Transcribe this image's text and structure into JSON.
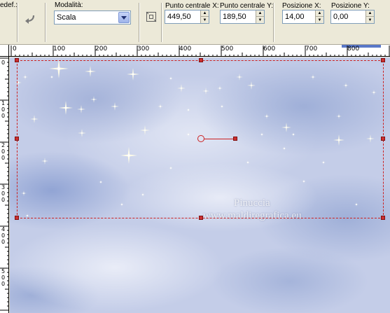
{
  "toolbar": {
    "preset_label": "edef.:",
    "mode": {
      "label": "Modalità:",
      "value": "Scala"
    },
    "center_x": {
      "label": "Punto centrale X:",
      "value": "449,50"
    },
    "center_y": {
      "label": "Punto centrale Y:",
      "value": "189,50"
    },
    "pos_x": {
      "label": "Posizione X:",
      "value": "14,00"
    },
    "pos_y": {
      "label": "Posizione Y:",
      "value": "0,00"
    }
  },
  "ruler_top": [
    "0",
    "100",
    "200",
    "300",
    "400",
    "500",
    "600",
    "700",
    "800"
  ],
  "ruler_left": [
    "0",
    "1\n0\n0",
    "2\n0\n0",
    "3\n0\n0",
    "4\n0\n0",
    "5\n0\n0"
  ],
  "canvas": {
    "watermark_line1": "Pinuccia",
    "watermark_line2": "www.maldiregrafica.eu"
  },
  "icons": [
    "undo-arrow-icon",
    "dropdown-arrow-icon",
    "center-on-canvas-icon",
    "spin-up-icon",
    "spin-down-icon"
  ],
  "colors": {
    "selection": "#cc2020",
    "toolbar_bg": "#ece9d8",
    "sky": "#c4cde8"
  }
}
